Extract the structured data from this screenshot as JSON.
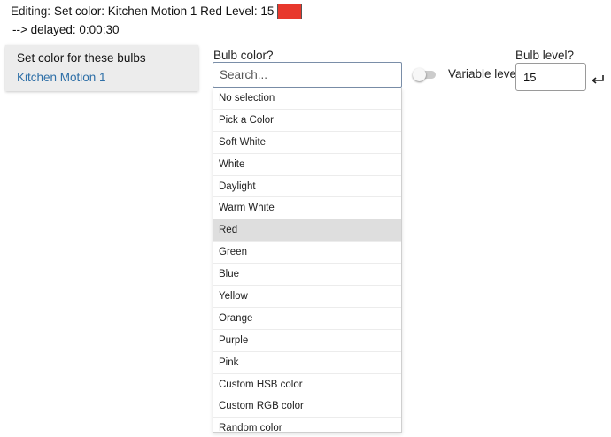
{
  "header": {
    "prefix": "Editing:",
    "description": "Set color: Kitchen Motion 1  Red  Level: 15",
    "swatch_color": "#e8382c",
    "delay": "--> delayed: 0:00:30"
  },
  "bulbs_card": {
    "title": "Set color for these bulbs",
    "device": "Kitchen Motion 1"
  },
  "bulb_color": {
    "label": "Bulb color?",
    "search_placeholder": "Search...",
    "options": [
      "No selection",
      "Pick a Color",
      "Soft White",
      "White",
      "Daylight",
      "Warm White",
      "Red",
      "Green",
      "Blue",
      "Yellow",
      "Orange",
      "Purple",
      "Pink",
      "Custom HSB color",
      "Custom RGB color",
      "Random color"
    ],
    "selected": "Red"
  },
  "variable_level": {
    "label": "Variable level?",
    "enabled": false
  },
  "bulb_level": {
    "label": "Bulb level?",
    "value": "15",
    "enter_icon": "enter-return-icon"
  },
  "colors": {
    "link": "#2e6fa7",
    "highlight": "#dedede",
    "card_bg": "#ececec"
  }
}
